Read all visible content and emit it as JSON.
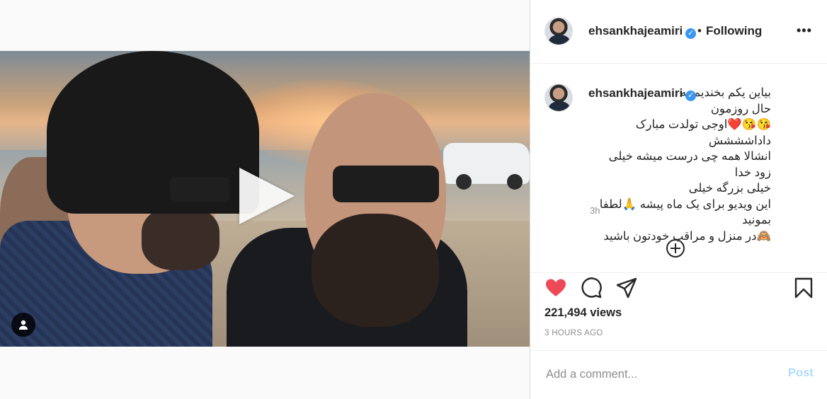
{
  "post": {
    "author": "ehsankhajeamiri",
    "verified_mark": "✓",
    "follow_dot": "•",
    "follow_status": "Following",
    "more_label": "•••",
    "caption_lines": [
      "بیاین یکم بخندیم به",
      "حال روزمون",
      "😘😘❤️اوجی تولدت مبارک داداشششش",
      "انشالا همه چی درست میشه خیلی زود خدا",
      "خیلی بزرگه خیلی",
      "این ویدیو برای یک ماه پیشه 🙏لطفا بمونید",
      "🙈در منزل و مراقب خودتون باشید"
    ],
    "caption_time": "3h",
    "views": "221,494 views",
    "posted_time": "3 HOURS AGO",
    "liked": true
  },
  "comment": {
    "placeholder": "Add a comment...",
    "post_label": "Post"
  },
  "icons": {
    "like": "heart-icon",
    "comment": "comment-icon",
    "share": "share-icon",
    "save": "bookmark-icon",
    "play": "play-icon",
    "tag": "user-tag-icon",
    "more": "more-icon",
    "load_more": "plus-circle-icon"
  },
  "colors": {
    "like": "#ed4956",
    "verified": "#3897f0",
    "post_button_disabled": "#b3dbff",
    "meta_text": "#8e8e8e"
  }
}
